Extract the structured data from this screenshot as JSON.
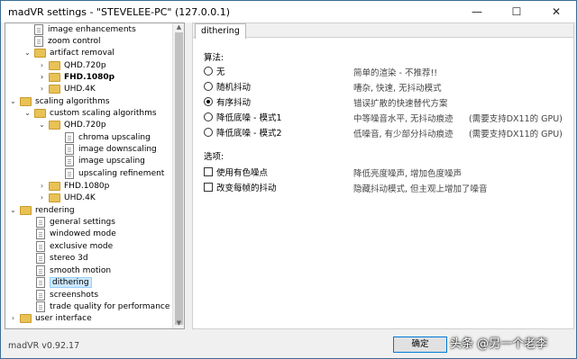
{
  "window": {
    "title": "madVR settings - \"STEVELEE-PC\" (127.0.0.1)",
    "minimize": "—",
    "maximize": "☐",
    "close": "✕"
  },
  "tree": {
    "image_enhancements": "image enhancements",
    "zoom_control": "zoom control",
    "artifact_removal": "artifact removal",
    "qhd720p_a": "QHD.720p",
    "fhd1080p_a": "FHD.1080p",
    "uhd4k_a": "UHD.4K",
    "scaling_algorithms": "scaling algorithms",
    "custom_scaling": "custom scaling algorithms",
    "qhd720p_b": "QHD.720p",
    "chroma_upscaling": "chroma upscaling",
    "image_downscaling": "image downscaling",
    "image_upscaling": "image upscaling",
    "upscaling_refinement": "upscaling refinement",
    "fhd1080p_b": "FHD.1080p",
    "uhd4k_b": "UHD.4K",
    "rendering": "rendering",
    "general_settings": "general settings",
    "windowed_mode": "windowed mode",
    "exclusive_mode": "exclusive mode",
    "stereo_3d": "stereo 3d",
    "smooth_motion": "smooth motion",
    "dithering": "dithering",
    "screenshots": "screenshots",
    "trade_quality": "trade quality for performance",
    "user_interface": "user interface"
  },
  "panel": {
    "tab": "dithering",
    "algo_label": "算法:",
    "algos": [
      {
        "label": "无",
        "desc": "简单的渲染 - 不推荐!!"
      },
      {
        "label": "随机抖动",
        "desc": "嘈杂, 快速, 无抖动模式"
      },
      {
        "label": "有序抖动",
        "desc": "错误扩散的快速替代方案"
      },
      {
        "label": "降低底噪 - 模式1",
        "desc": "中等噪音水平, 无抖动痕迹",
        "req": "(需要支持DX11的 GPU)"
      },
      {
        "label": "降低底噪 - 模式2",
        "desc": "低噪音, 有少部分抖动痕迹",
        "req": "(需要支持DX11的 GPU)"
      }
    ],
    "options_label": "选项:",
    "options": [
      {
        "label": "使用有色噪点",
        "desc": "降低亮度噪声, 增加色度噪声"
      },
      {
        "label": "改变每帧的抖动",
        "desc": "隐藏抖动模式, 但主观上增加了噪音"
      }
    ]
  },
  "footer": {
    "version": "madVR v0.92.17",
    "ok": "确定"
  },
  "watermark": "头条 @另一个老李"
}
